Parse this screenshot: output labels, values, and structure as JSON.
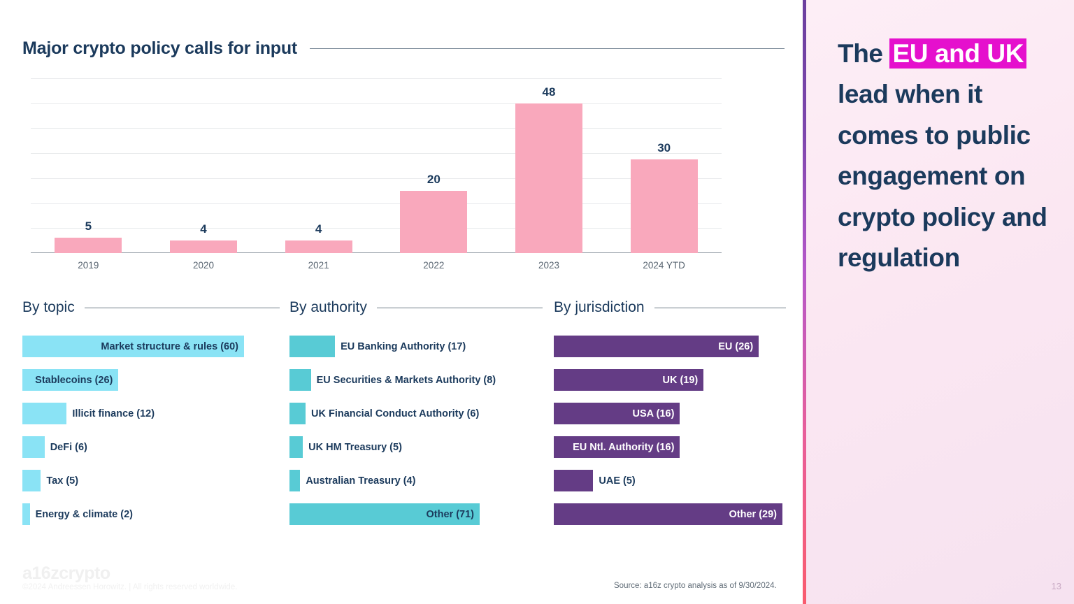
{
  "slide": {
    "title": "Major crypto policy calls for input",
    "page_number": "13",
    "source_note": "Source: a16z crypto analysis as of 9/30/2024.",
    "logo": "a16zcrypto",
    "copyright": "©2024 Andreessen Horowitz. |  All rights reserved worldwide."
  },
  "right_panel": {
    "headline_parts": [
      {
        "text": "The ",
        "highlight": false
      },
      {
        "text": "EU and UK",
        "highlight": true
      },
      {
        "text": " lead when it comes to public engagement on crypto policy and regulation",
        "highlight": false
      }
    ],
    "headline_plain": "The EU and UK lead when it comes to public engagement on crypto policy and regulation",
    "highlight_color": "#E510CD",
    "text_color": "#1b3a5c",
    "background_color": "#fceaf4"
  },
  "chart_data": [
    {
      "type": "bar",
      "name": "policy-calls-by-year",
      "title": "Major crypto policy calls for input",
      "xlabel": "",
      "ylabel": "",
      "categories": [
        "2019",
        "2020",
        "2021",
        "2022",
        "2023",
        "2024 YTD"
      ],
      "values": [
        5,
        4,
        4,
        20,
        48,
        30
      ],
      "ylim": [
        0,
        56
      ],
      "grid": true,
      "gridlines": [
        8,
        16,
        24,
        32,
        40,
        48,
        56
      ],
      "legend": "none",
      "bar_color": "#F9A8BC",
      "label_color": "#1b3a5c"
    },
    {
      "type": "bar",
      "orientation": "horizontal",
      "name": "by-topic",
      "title": "By topic",
      "categories": [
        "Market structure & rules",
        "Stablecoins",
        "Illicit finance",
        "DeFi",
        "Tax",
        "Energy & climate"
      ],
      "values": [
        60,
        26,
        12,
        6,
        5,
        2
      ],
      "labels": [
        "Market structure & rules (60)",
        "Stablecoins (26)",
        "Illicit finance (12)",
        "DeFi (6)",
        "Tax (5)",
        "Energy & climate (2)"
      ],
      "label_inside": [
        true,
        true,
        false,
        false,
        false,
        false
      ],
      "bar_color": "#8AE3F5",
      "label_color": "#1b3a5c",
      "max": 60,
      "xlim": [
        0,
        60
      ]
    },
    {
      "type": "bar",
      "orientation": "horizontal",
      "name": "by-authority",
      "title": "By authority",
      "categories": [
        "EU Banking Authority",
        "EU Securities & Markets Authority",
        "UK Financial Conduct Authority",
        "UK HM Treasury",
        "Australian Treasury",
        "Other"
      ],
      "values": [
        17,
        8,
        6,
        5,
        4,
        71
      ],
      "labels": [
        "EU Banking Authority (17)",
        "EU Securities & Markets Authority (8)",
        "UK Financial Conduct Authority (6)",
        "UK HM Treasury (5)",
        "Australian Treasury (4)",
        "Other (71)"
      ],
      "label_inside": [
        false,
        false,
        false,
        false,
        false,
        true
      ],
      "bar_color": "#58CBD5",
      "label_color": "#1b3a5c",
      "max": 71,
      "xlim": [
        0,
        71
      ]
    },
    {
      "type": "bar",
      "orientation": "horizontal",
      "name": "by-jurisdiction",
      "title": "By jurisdiction",
      "categories": [
        "EU",
        "UK",
        "USA",
        "EU Ntl. Authority",
        "UAE",
        "Other"
      ],
      "values": [
        26,
        19,
        16,
        16,
        5,
        29
      ],
      "labels": [
        "EU (26)",
        "UK (19)",
        "USA (16)",
        "EU Ntl. Authority (16)",
        "UAE (5)",
        "Other (29)"
      ],
      "label_inside": [
        true,
        true,
        true,
        true,
        false,
        true
      ],
      "bar_color": "#643C85",
      "inside_label_color": "#ffffff",
      "label_color": "#1b3a5c",
      "max": 29,
      "xlim": [
        0,
        29
      ]
    }
  ]
}
